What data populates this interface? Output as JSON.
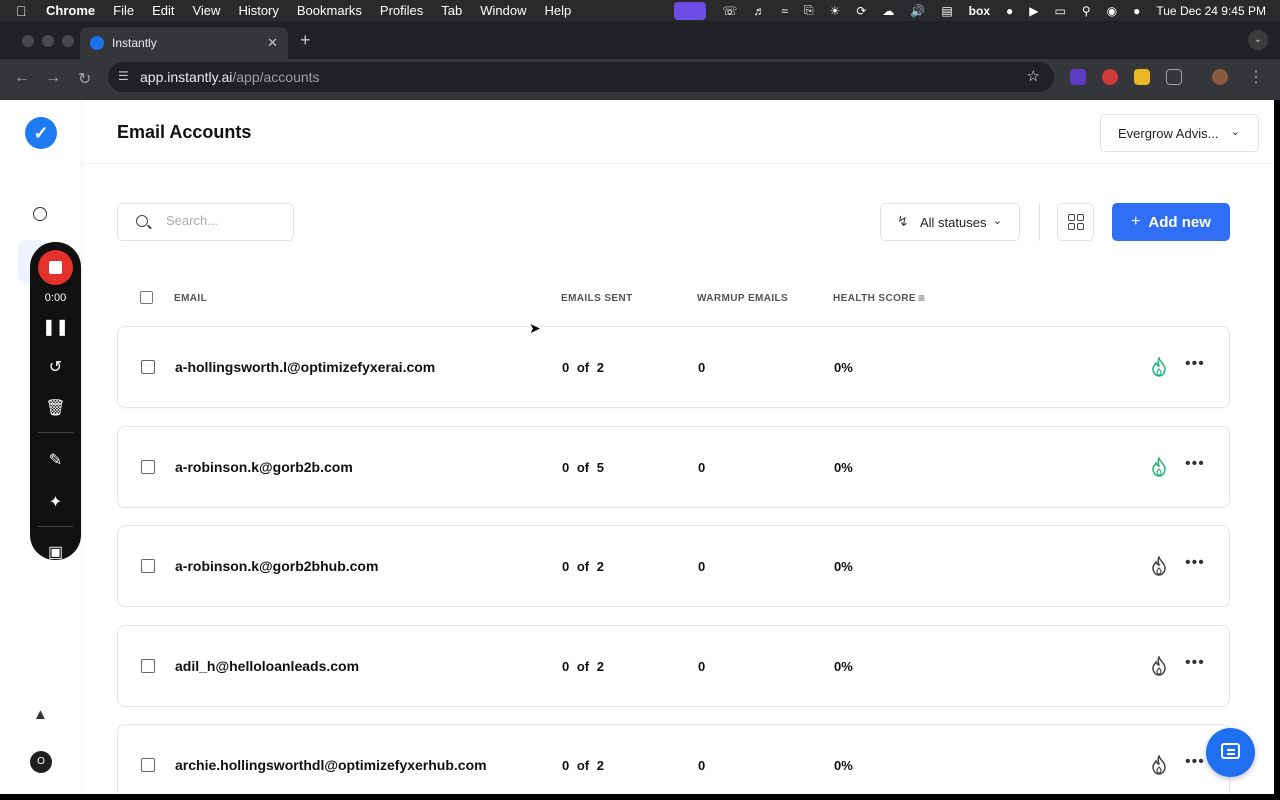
{
  "menubar": {
    "app_name": "Chrome",
    "items": [
      "File",
      "Edit",
      "View",
      "History",
      "Bookmarks",
      "Profiles",
      "Tab",
      "Window",
      "Help"
    ],
    "box_label": "box",
    "clock": "Tue Dec 24  9:45 PM"
  },
  "browser": {
    "tab_title": "Instantly",
    "url_host": "app.instantly.ai",
    "url_path": "/app/accounts"
  },
  "sidebar": {
    "logo_icon": "bolt-icon",
    "avatar_initial": "O"
  },
  "recorder": {
    "time": "0:00"
  },
  "header": {
    "title": "Email Accounts",
    "workspace": "Evergrow Advis..."
  },
  "controls": {
    "search_placeholder": "Search...",
    "status_filter": "All statuses",
    "add_new_label": "Add new"
  },
  "table": {
    "columns": [
      "EMAIL",
      "EMAILS SENT",
      "WARMUP EMAILS",
      "HEALTH SCORE"
    ],
    "rows": [
      {
        "email": "a-hollingsworth.l@optimizefyxerai.com",
        "sent": "0  of  2",
        "warmup": "0",
        "health": "0%",
        "warmup_active": true
      },
      {
        "email": "a-robinson.k@gorb2b.com",
        "sent": "0  of  5",
        "warmup": "0",
        "health": "0%",
        "warmup_active": true
      },
      {
        "email": "a-robinson.k@gorb2bhub.com",
        "sent": "0  of  2",
        "warmup": "0",
        "health": "0%",
        "warmup_active": false
      },
      {
        "email": "adil_h@helloloanleads.com",
        "sent": "0  of  2",
        "warmup": "0",
        "health": "0%",
        "warmup_active": false
      },
      {
        "email": "archie.hollingsworthdl@optimizefyxerhub.com",
        "sent": "0  of  2",
        "warmup": "0",
        "health": "0%",
        "warmup_active": false
      }
    ]
  },
  "colors": {
    "accent": "#2f6ef5",
    "warmup_active": "#22b573",
    "warmup_inactive": "#444444",
    "record": "#e4312b"
  }
}
